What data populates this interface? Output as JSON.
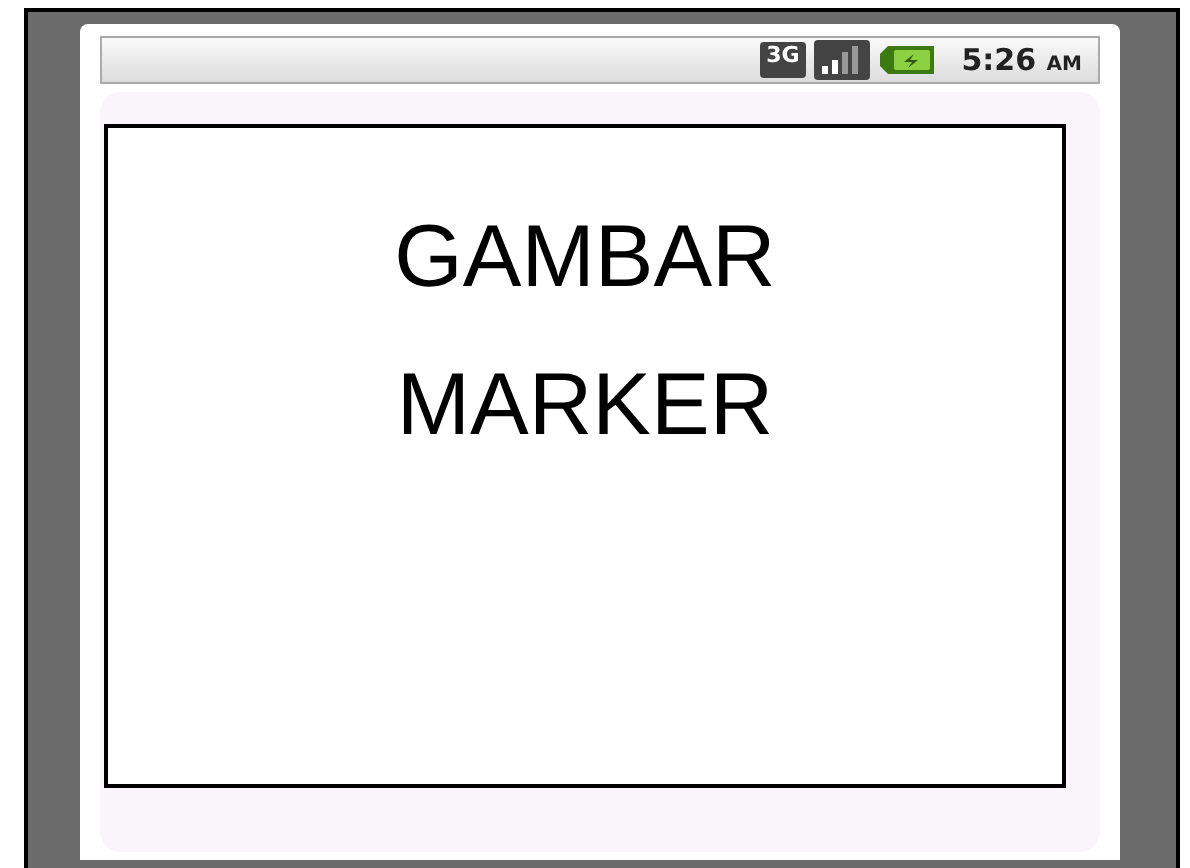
{
  "status_bar": {
    "network": "3G",
    "time": "5:26",
    "meridiem": "AM"
  },
  "content": {
    "lines": [
      "GAMBAR",
      "MARKER"
    ]
  }
}
